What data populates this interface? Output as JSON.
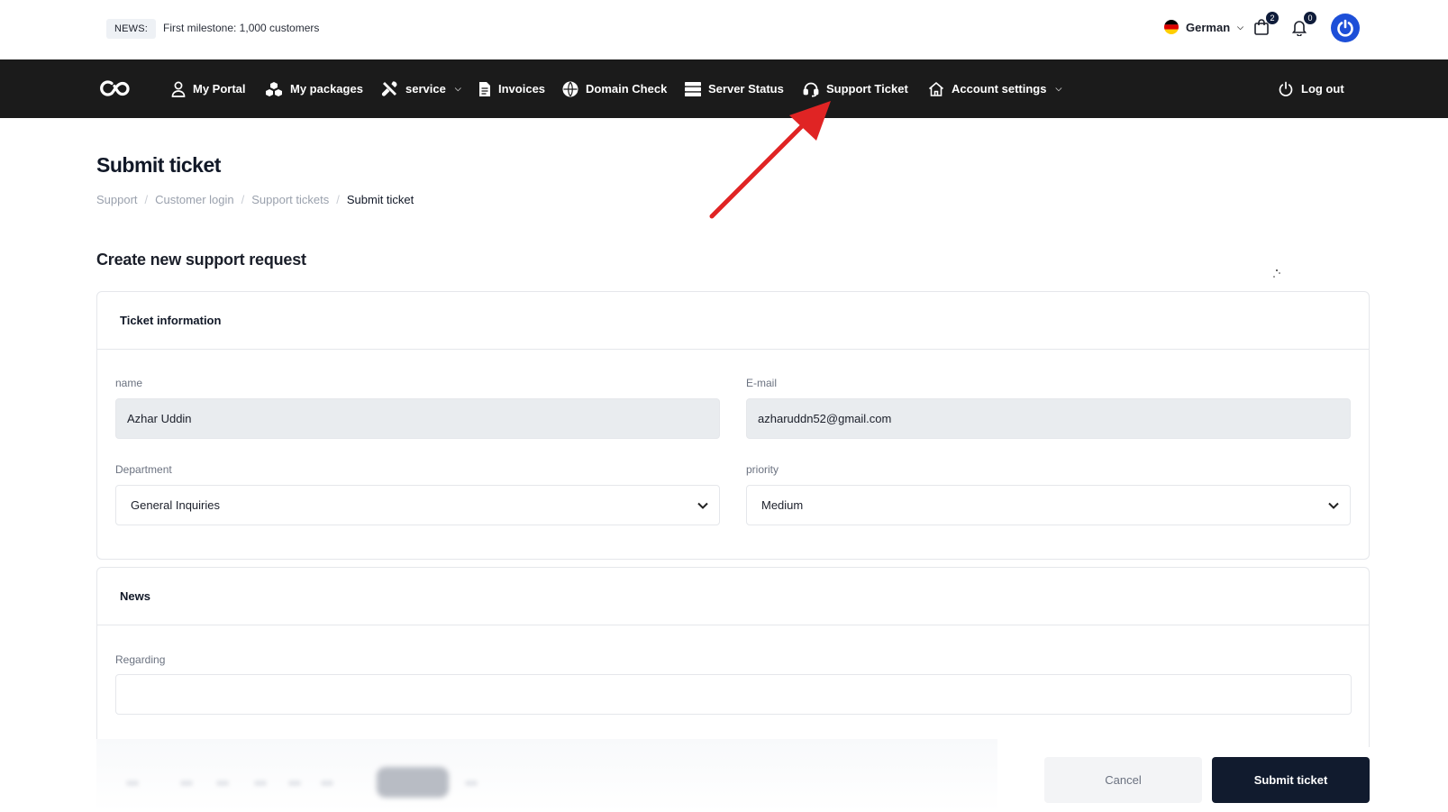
{
  "topbar": {
    "news_badge": "NEWS:",
    "news_text": "First milestone: 1,000 customers",
    "language": "German",
    "cart_count": "2",
    "notification_count": "0"
  },
  "nav": {
    "items": [
      {
        "label": "My Portal",
        "icon": "user-icon"
      },
      {
        "label": "My packages",
        "icon": "packages-icon"
      },
      {
        "label": "service",
        "icon": "tools-icon",
        "dropdown": true
      },
      {
        "label": "Invoices",
        "icon": "invoice-icon"
      },
      {
        "label": "Domain Check",
        "icon": "globe-icon"
      },
      {
        "label": "Server Status",
        "icon": "server-icon"
      },
      {
        "label": "Support Ticket",
        "icon": "headset-icon"
      },
      {
        "label": "Account settings",
        "icon": "home-icon",
        "dropdown": true
      }
    ],
    "logout": "Log out"
  },
  "page": {
    "title": "Submit ticket",
    "breadcrumb": [
      "Support",
      "Customer login",
      "Support tickets",
      "Submit ticket"
    ],
    "section_title": "Create new support request"
  },
  "ticket_info": {
    "heading": "Ticket information",
    "name_label": "name",
    "name_value": "Azhar Uddin",
    "email_label": "E-mail",
    "email_value": "azharuddn52@gmail.com",
    "department_label": "Department",
    "department_value": "General Inquiries",
    "priority_label": "priority",
    "priority_value": "Medium"
  },
  "news": {
    "heading": "News",
    "regarding_label": "Regarding",
    "regarding_value": ""
  },
  "actions": {
    "cancel": "Cancel",
    "submit": "Submit ticket"
  },
  "colors": {
    "navbar": "#1b1b1b",
    "submit_button": "#111b2e",
    "accent_blue": "#1d4fd8",
    "annotation_arrow": "#e02424"
  }
}
